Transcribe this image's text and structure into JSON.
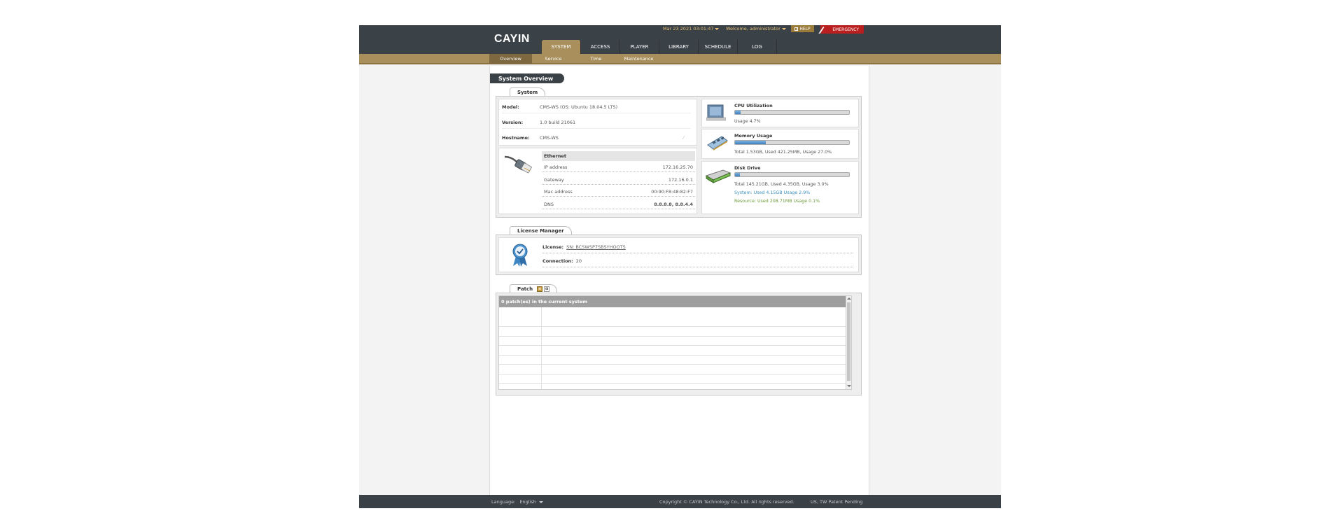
{
  "header": {
    "logo": "CAYIN",
    "datetime": "Mar 23 2021 03:01:47",
    "welcome": "Welcome, administrator",
    "help_label": "HELP",
    "emergency_label": "EMERGENCY",
    "tabs": [
      {
        "label": "SYSTEM",
        "active": true
      },
      {
        "label": "ACCESS",
        "active": false
      },
      {
        "label": "PLAYER",
        "active": false
      },
      {
        "label": "LIBRARY",
        "active": false
      },
      {
        "label": "SCHEDULE",
        "active": false
      },
      {
        "label": "LOG",
        "active": false
      }
    ],
    "subtabs": [
      {
        "label": "Overview",
        "active": true
      },
      {
        "label": "Service",
        "active": false
      },
      {
        "label": "Time",
        "active": false
      },
      {
        "label": "Maintenance",
        "active": false
      }
    ]
  },
  "page_title": "System Overview",
  "system": {
    "section_label": "System",
    "model_label": "Model:",
    "model_value": "CMS-WS (OS: Ubuntu 18.04.5 LTS)",
    "version_label": "Version:",
    "version_value": "1.0 build 21061",
    "hostname_label": "Hostname:",
    "hostname_value": "CMS-WS",
    "ethernet": {
      "title": "Ethernet",
      "rows": [
        {
          "label": "IP address",
          "value": "172.16.25.70"
        },
        {
          "label": "Gateway",
          "value": "172.16.0.1"
        },
        {
          "label": "Mac address",
          "value": "00:90:F8:48:82:F7"
        },
        {
          "label": "DNS",
          "value": "8.8.8.8, 8.8.4.4"
        }
      ]
    },
    "cpu": {
      "title": "CPU Utilization",
      "usage_text": "Usage 4.7%",
      "usage_percent": 4.7
    },
    "memory": {
      "title": "Memory Usage",
      "usage_text": "Total 1.53GB, Used 421.25MB, Usage 27.0%",
      "usage_percent": 27.0
    },
    "disk": {
      "title": "Disk Drive",
      "usage_text": "Total 145.21GB, Used 4.35GB, Usage 3.0%",
      "usage_percent": 3.0,
      "system_text": "System: Used 4.15GB Usage 2.9%",
      "resource_text": "Resource: Used 208.71MB Usage 0.1%"
    }
  },
  "license": {
    "section_label": "License Manager",
    "license_label": "License:",
    "license_value": "SN: BCSWSP7SBSYHOOTS",
    "connection_label": "Connection:",
    "connection_value": "20"
  },
  "patch": {
    "section_label": "Patch",
    "header_text": "0 patch(es) in the current system"
  },
  "footer": {
    "language_label": "Language:",
    "language_value": "English",
    "copyright": "Copyright © CAYIN Technology Co., Ltd. All rights reserved.",
    "patent": "US, TW Patent Pending"
  },
  "colors": {
    "header_bg": "#3a4147",
    "accent_gold": "#a88f5c",
    "emergency_red": "#b91f1f",
    "datetime_text": "#e8c27a",
    "disk_system_text": "#3a8fbf",
    "disk_resource_text": "#6b9a3a"
  },
  "icons": {
    "cpu": "cpu-chip-icon",
    "memory": "memory-module-icon",
    "disk": "hard-drive-icon",
    "ethernet": "ethernet-cable-icon",
    "license": "certificate-ribbon-icon"
  }
}
